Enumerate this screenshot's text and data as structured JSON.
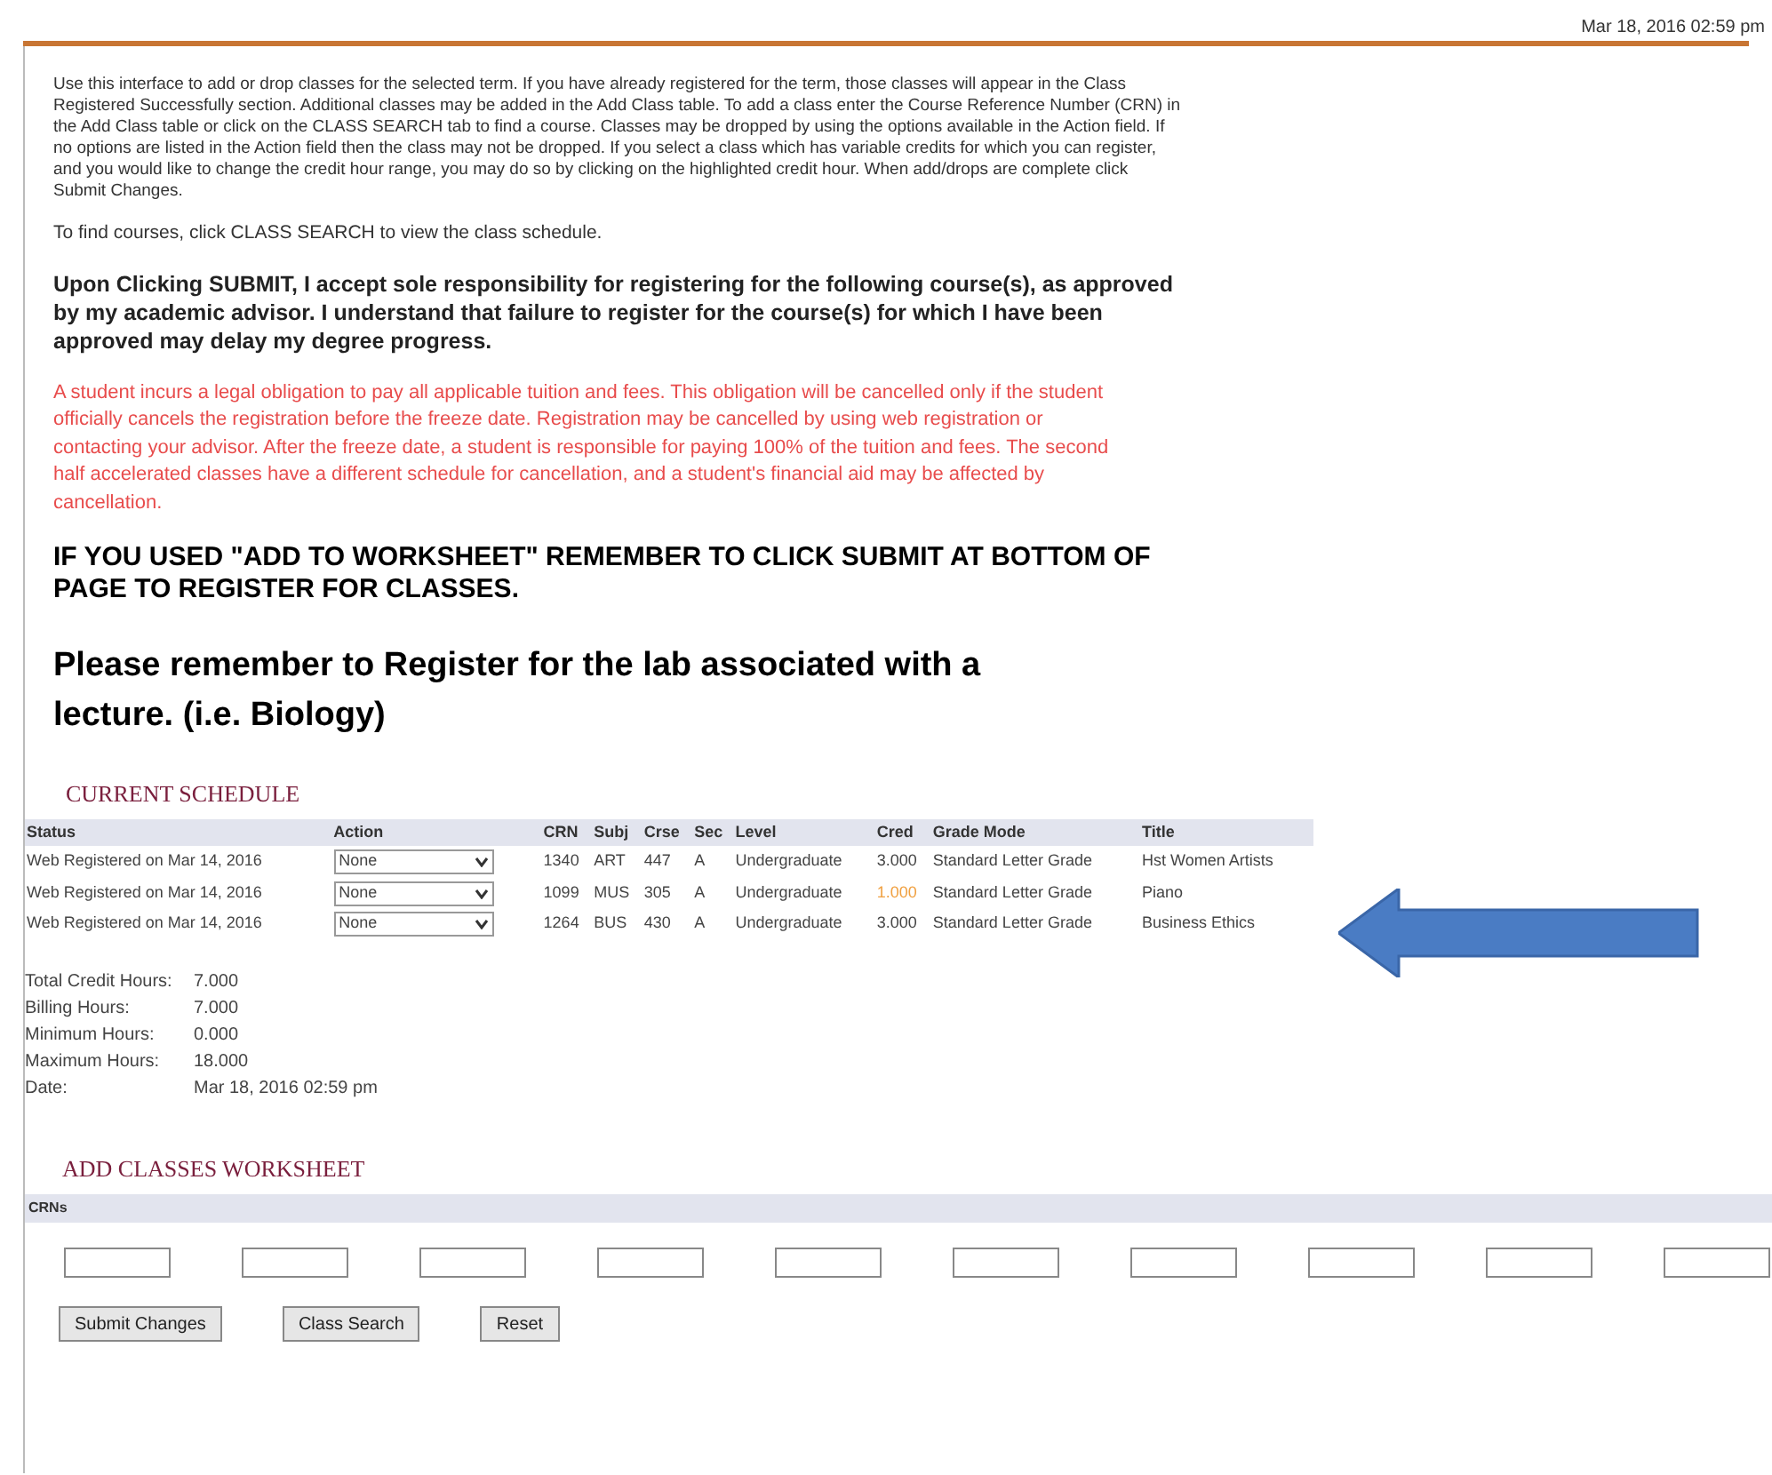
{
  "header": {
    "date": "Mar 18, 2016 02:59 pm"
  },
  "intro": "Use this interface to add or drop classes for the selected term. If you have already registered for the term, those classes will appear in the Class Registered Successfully section. Additional classes may be added in the Add Class table. To add a class enter the Course Reference Number (CRN) in the Add Class table or click on the CLASS SEARCH tab to find a course. Classes may be dropped by using the options available in the Action field. If no options are listed in the Action field then the class may not be dropped. If you select a class which has variable credits for which you can register, and you would like to change the credit hour range, you may do so by clicking on the highlighted credit hour. When add/drops are complete click Submit Changes.",
  "find_courses": "To find courses, click CLASS SEARCH to view the class schedule.",
  "acknowledgement": "Upon Clicking SUBMIT, I accept sole responsibility for registering for the following course(s), as approved by my academic advisor. I understand that failure to register for the course(s) for which I have been approved may delay my degree progress.",
  "obligation": "A student incurs a legal obligation to pay all applicable tuition and fees. This obligation will be cancelled only if the student officially cancels the registration before the freeze date. Registration may be cancelled by using web registration or contacting your advisor. After the freeze date, a student is responsible for paying 100% of the tuition and fees. The second half accelerated classes have a different schedule for cancellation, and a student's financial aid may be affected by cancellation.",
  "worksheet_notice": "IF YOU USED \"ADD TO WORKSHEET\" REMEMBER TO CLICK SUBMIT AT BOTTOM OF PAGE TO REGISTER FOR CLASSES.",
  "lab_notice": "Please remember to Register for the lab associated with a lecture. (i.e. Biology)",
  "current_schedule": {
    "title": "CURRENT SCHEDULE",
    "columns": [
      "Status",
      "Action",
      "CRN",
      "Subj",
      "Crse",
      "Sec",
      "Level",
      "Cred",
      "Grade Mode",
      "Title"
    ],
    "rows": [
      {
        "status": "Web Registered on Mar 14, 2016",
        "action": "None",
        "crn": "1340",
        "subj": "ART",
        "crse": "447",
        "sec": "A",
        "level": "Undergraduate",
        "cred": "3.000",
        "cred_highlighted": false,
        "grade_mode": "Standard Letter Grade",
        "title": "Hst Women Artists"
      },
      {
        "status": "Web Registered on Mar 14, 2016",
        "action": "None",
        "crn": "1099",
        "subj": "MUS",
        "crse": "305",
        "sec": "A",
        "level": "Undergraduate",
        "cred": "1.000",
        "cred_highlighted": true,
        "grade_mode": "Standard Letter Grade",
        "title": "Piano"
      },
      {
        "status": "Web Registered on Mar 14, 2016",
        "action": "None",
        "crn": "1264",
        "subj": "BUS",
        "crse": "430",
        "sec": "A",
        "level": "Undergraduate",
        "cred": "3.000",
        "cred_highlighted": false,
        "grade_mode": "Standard Letter Grade",
        "title": "Business Ethics"
      }
    ]
  },
  "totals": [
    {
      "label": "Total Credit Hours:",
      "value": "7.000"
    },
    {
      "label": "Billing Hours:",
      "value": "7.000"
    },
    {
      "label": "Minimum Hours:",
      "value": "0.000"
    },
    {
      "label": "Maximum Hours:",
      "value": "18.000"
    },
    {
      "label": "Date:",
      "value": "Mar 18, 2016 02:59 pm"
    }
  ],
  "worksheet": {
    "title": "ADD CLASSES WORKSHEET",
    "label": "CRNs"
  },
  "buttons": [
    "Submit Changes",
    "Class Search",
    "Reset"
  ]
}
